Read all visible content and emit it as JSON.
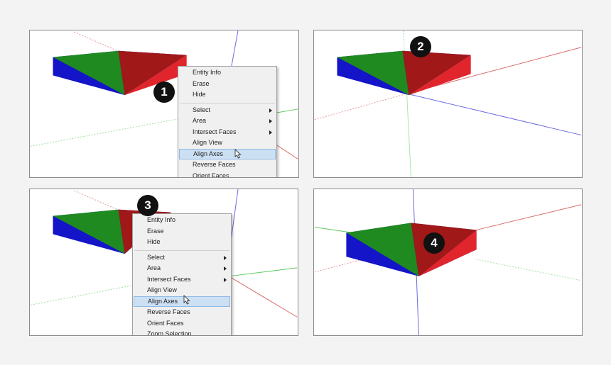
{
  "colors": {
    "red_face": "#e0262c",
    "green_face": "#1f8a1f",
    "blue_face": "#1414c8",
    "axis_red": "#d96b6b",
    "axis_green": "#5cc75c",
    "axis_blue": "#6a6ae0",
    "badge_bg": "#111111",
    "menu_highlight": "#cce0f4"
  },
  "steps": [
    {
      "number": "1"
    },
    {
      "number": "2"
    },
    {
      "number": "3"
    },
    {
      "number": "4"
    }
  ],
  "context_menu_1": {
    "items": [
      {
        "label": "Entity Info"
      },
      {
        "label": "Erase"
      },
      {
        "label": "Hide"
      },
      {
        "label": "Select",
        "submenu": true
      },
      {
        "label": "Area",
        "submenu": true
      },
      {
        "label": "Intersect Faces",
        "submenu": true
      },
      {
        "label": "Align View"
      },
      {
        "label": "Align Axes",
        "highlighted": true
      },
      {
        "label": "Reverse Faces"
      },
      {
        "label": "Orient Faces"
      }
    ]
  },
  "context_menu_3": {
    "items": [
      {
        "label": "Entity Info"
      },
      {
        "label": "Erase"
      },
      {
        "label": "Hide"
      },
      {
        "label": "Select",
        "submenu": true
      },
      {
        "label": "Area",
        "submenu": true
      },
      {
        "label": "Intersect Faces",
        "submenu": true
      },
      {
        "label": "Align View"
      },
      {
        "label": "Align Axes",
        "highlighted": true
      },
      {
        "label": "Reverse Faces"
      },
      {
        "label": "Orient Faces"
      },
      {
        "label": "Zoom Selection"
      }
    ]
  }
}
